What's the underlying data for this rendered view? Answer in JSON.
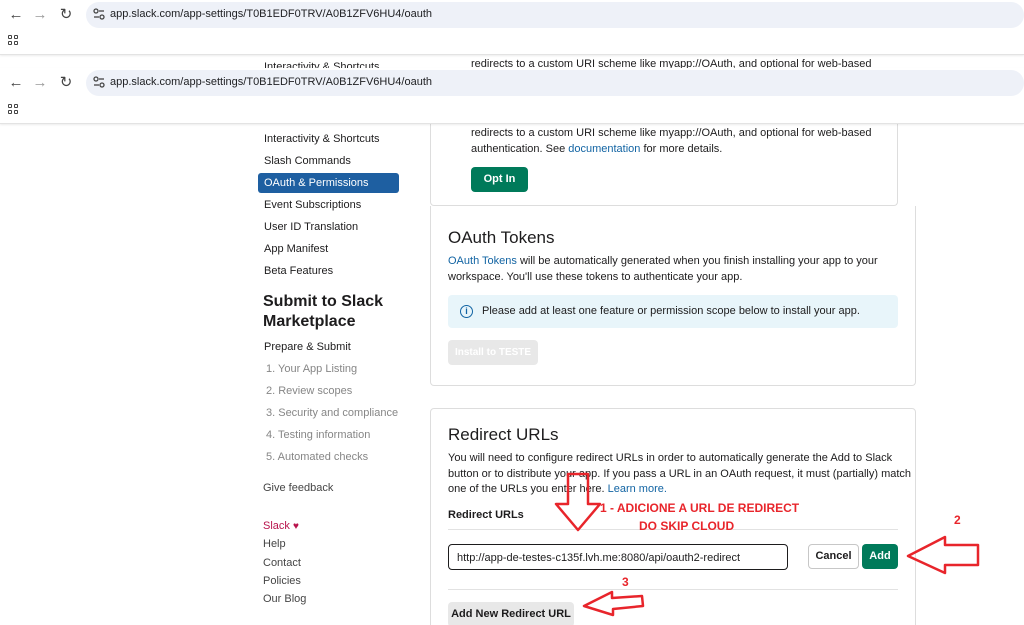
{
  "browser": {
    "url": "app.slack.com/app-settings/T0B1EDF0TRV/A0B1ZFV6HU4/oauth"
  },
  "background_peek": {
    "sidebar_item": "Interactivity & Shortcuts",
    "card_text": "redirects to a custom URI scheme like myapp://OAuth, and optional for web-based"
  },
  "sidebar": {
    "items": [
      {
        "label": "Interactivity & Shortcuts"
      },
      {
        "label": "Slash Commands"
      },
      {
        "label": "OAuth & Permissions",
        "active": true
      },
      {
        "label": "Event Subscriptions"
      },
      {
        "label": "User ID Translation"
      },
      {
        "label": "App Manifest"
      },
      {
        "label": "Beta Features"
      }
    ],
    "marketplace_heading": "Submit to Slack Marketplace",
    "prepare_submit": "Prepare & Submit",
    "steps": [
      "1. Your App Listing",
      "2. Review scopes",
      "3. Security and compliance",
      "4. Testing information",
      "5. Automated checks"
    ],
    "feedback": "Give feedback",
    "footer": {
      "slack": "Slack",
      "heart": "♥",
      "help": "Help",
      "contact": "Contact",
      "policies": "Policies",
      "blog": "Our Blog"
    }
  },
  "optin_card": {
    "line1": "redirects to a custom URI scheme like myapp://OAuth, and optional for web-based",
    "line2_pre": "authentication. See ",
    "line2_link": "documentation",
    "line2_post": " for more details.",
    "button": "Opt In"
  },
  "oauth_tokens": {
    "title": "OAuth Tokens",
    "link": "OAuth Tokens",
    "text1": " will be automatically generated when you finish installing your app to your",
    "text2": "workspace. You'll use these tokens to authenticate your app.",
    "info": "Please add at least one feature or permission scope below to install your app.",
    "install_button": "Install to TESTE"
  },
  "redirect_urls": {
    "title": "Redirect URLs",
    "line1": "You will need to configure redirect URLs in order to automatically generate the Add to Slack",
    "line2": "button or to distribute your app. If you pass a URL in an OAuth request, it must (partially) match",
    "line3_pre": "one of the URLs you enter here. ",
    "line3_link": "Learn more.",
    "subheading": "Redirect URLs",
    "input_value": "http://app-de-testes-c135f.lvh.me:8080/api/oauth2-redirect",
    "cancel": "Cancel",
    "add": "Add",
    "add_new": "Add New Redirect URL"
  },
  "annotations": {
    "step1_line1": "1 - ADICIONE A URL DE REDIRECT",
    "step1_line2": "DO SKIP CLOUD",
    "step2": "2",
    "step3": "3",
    "color": "#e8252b"
  }
}
